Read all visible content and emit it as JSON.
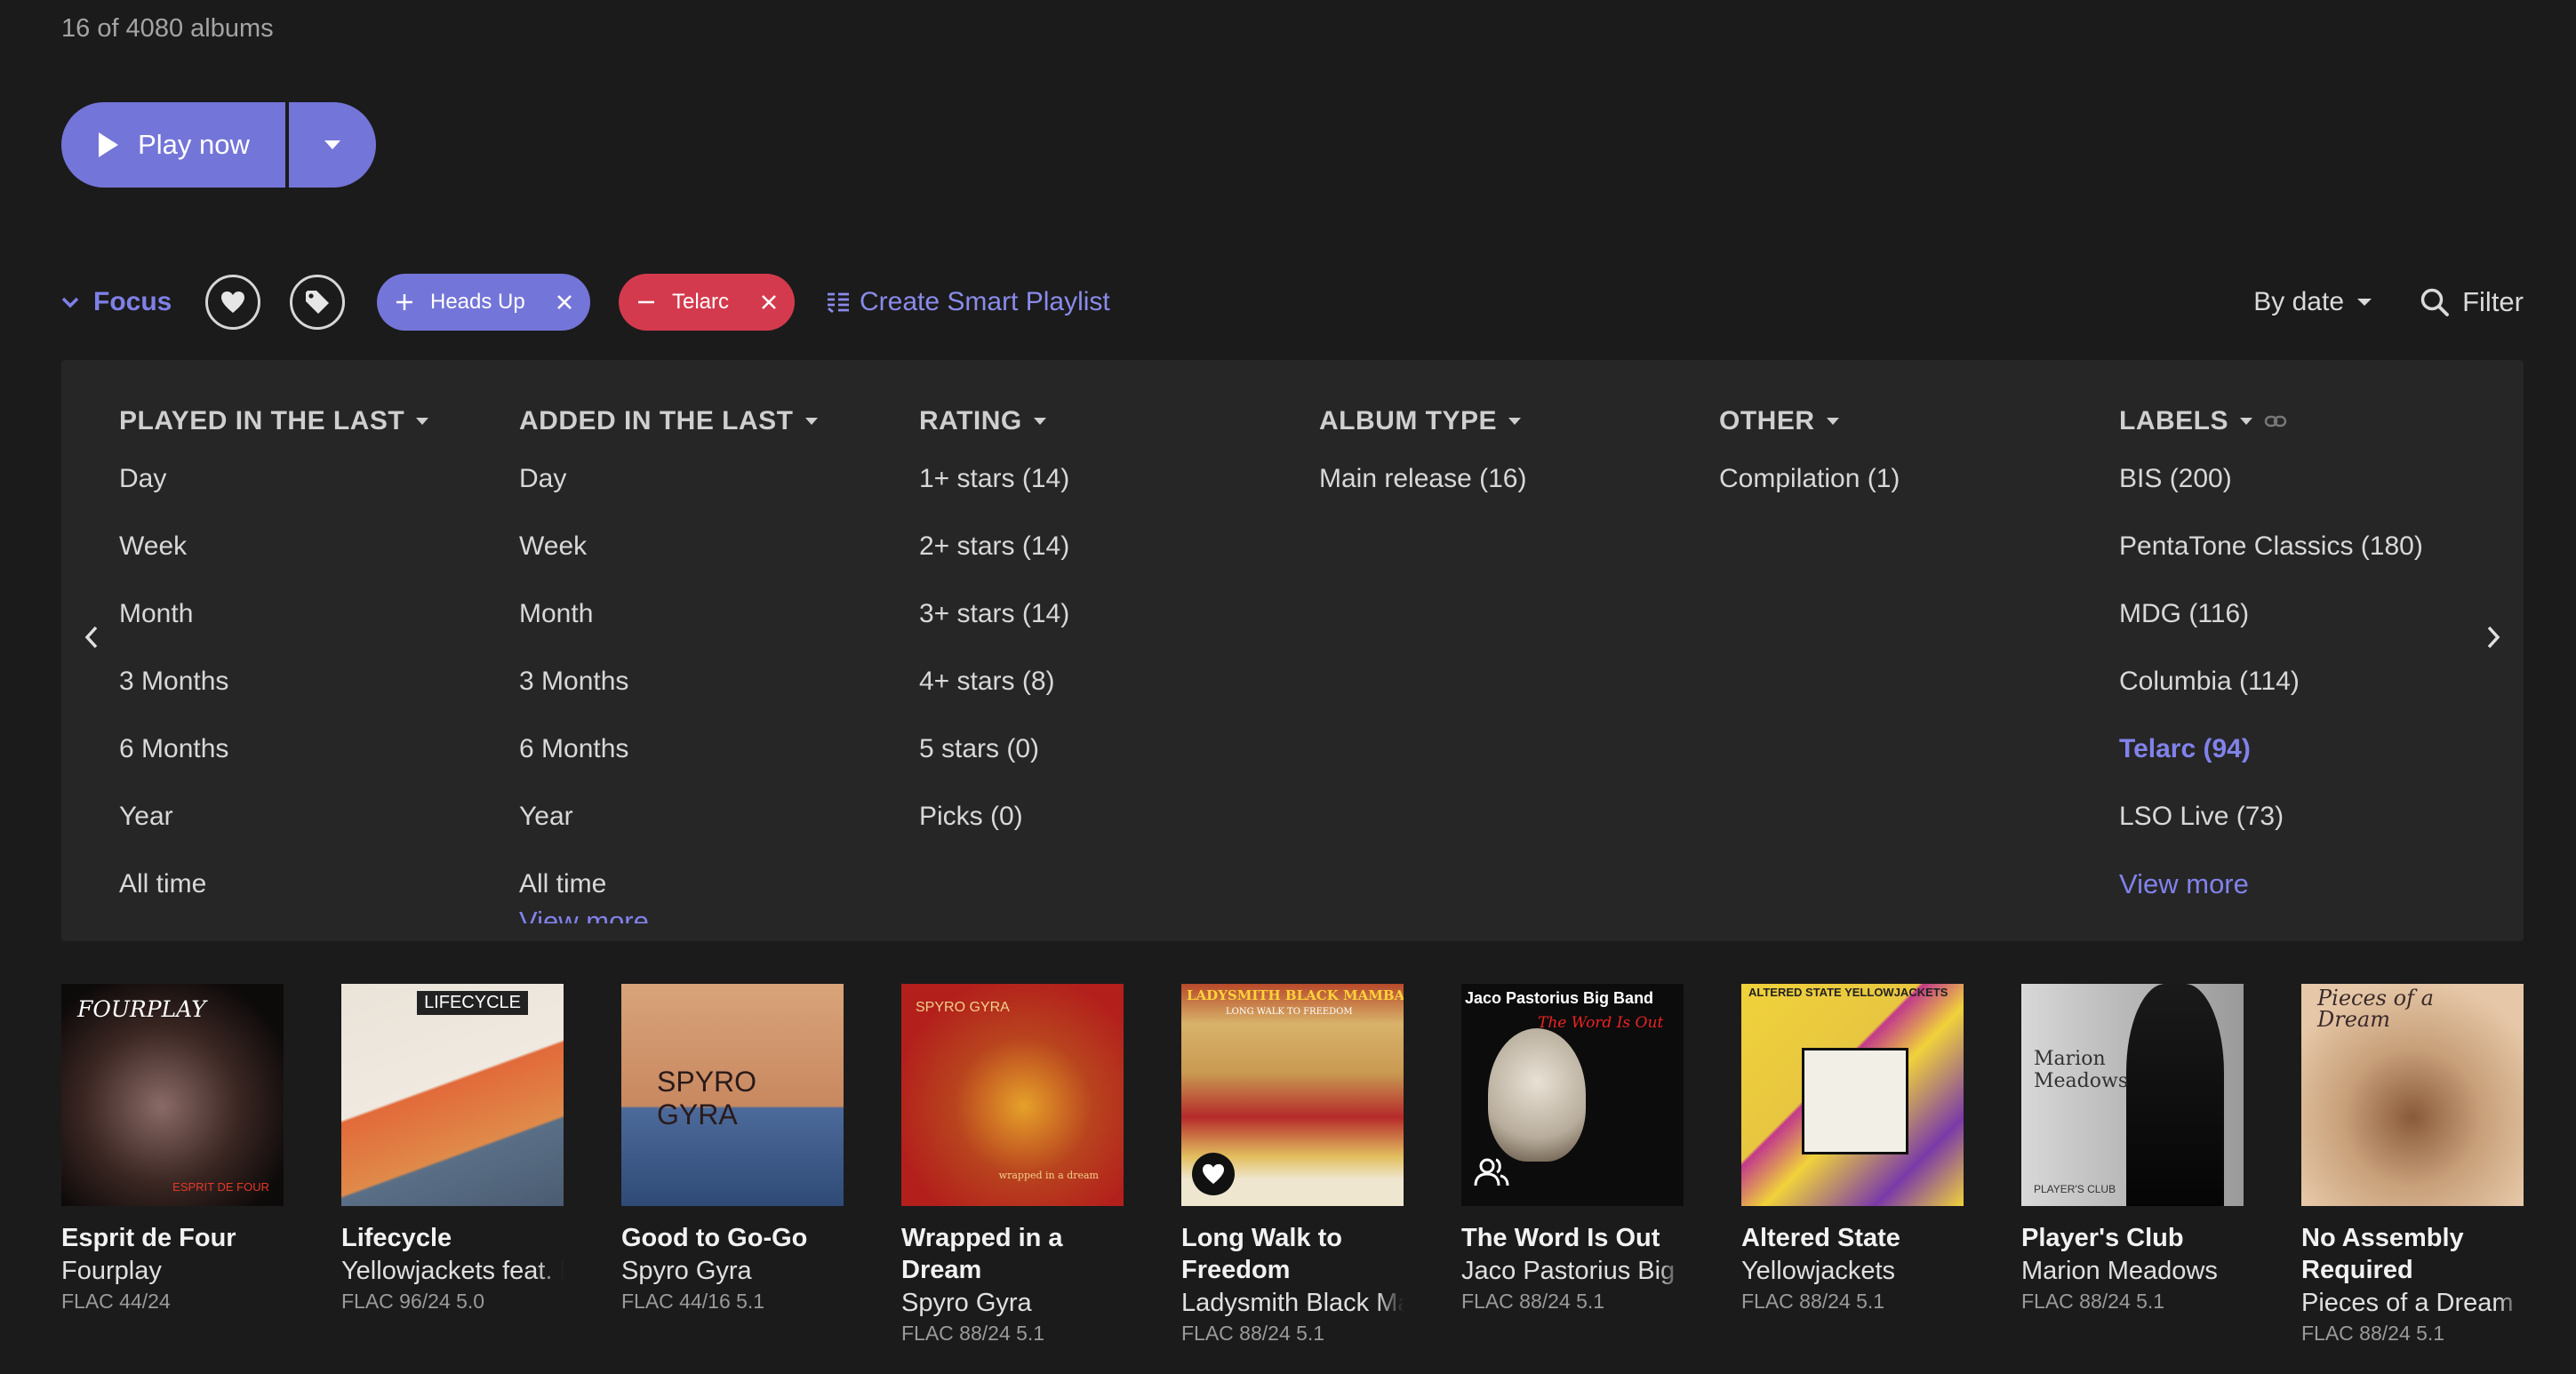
{
  "header": {
    "album_count": "16 of 4080 albums"
  },
  "play": {
    "label": "Play now"
  },
  "toolbar": {
    "focus_label": "Focus",
    "include_chip": "Heads Up",
    "exclude_chip": "Telarc",
    "smart_playlist": "Create Smart Playlist",
    "sort_label": "By date",
    "filter_label": "Filter"
  },
  "focus_panel": {
    "columns": [
      {
        "header": "PLAYED IN THE LAST",
        "items": [
          "Day",
          "Week",
          "Month",
          "3 Months",
          "6 Months",
          "Year",
          "All time"
        ]
      },
      {
        "header": "ADDED IN THE LAST",
        "items": [
          "Day",
          "Week",
          "Month",
          "3 Months",
          "6 Months",
          "Year",
          "All time"
        ],
        "view_more": "View more"
      },
      {
        "header": "RATING",
        "items": [
          "1+ stars (14)",
          "2+ stars (14)",
          "3+ stars (14)",
          "4+ stars (8)",
          "5 stars (0)",
          "Picks (0)"
        ]
      },
      {
        "header": "ALBUM TYPE",
        "items": [
          "Main release (16)"
        ]
      },
      {
        "header": "OTHER",
        "items": [
          "Compilation (1)"
        ]
      },
      {
        "header": "LABELS",
        "items": [
          "BIS (200)",
          "PentaTone Classics (180)",
          "MDG (116)",
          "Columbia (114)",
          "Telarc (94)",
          "LSO Live (73)"
        ],
        "active_item": "Telarc (94)",
        "view_more": "View more"
      }
    ]
  },
  "albums": [
    {
      "title": "Esprit de Four",
      "artist": "Fourplay",
      "format": "FLAC 44/24",
      "cover_text": "FOURPLAY",
      "cover_sub": "ESPRIT DE FOUR"
    },
    {
      "title": "Lifecycle",
      "artist": "Yellowjackets feat. Mike Stern",
      "format": "FLAC 96/24 5.0",
      "cover_text": "LIFECYCLE"
    },
    {
      "title": "Good to Go-Go",
      "artist": "Spyro Gyra",
      "format": "FLAC 44/16 5.1",
      "cover_text": "SPYRO GYRA"
    },
    {
      "title": "Wrapped in a Dream",
      "artist": "Spyro Gyra",
      "format": "FLAC 88/24 5.1",
      "cover_text": "SPYRO GYRA",
      "cover_sub": "wrapped in a dream"
    },
    {
      "title": "Long Walk to Freedom",
      "artist": "Ladysmith Black Mambazo",
      "format": "FLAC 88/24 5.1",
      "cover_text": "LADYSMITH BLACK MAMBAZO",
      "cover_sub": "LONG WALK TO FREEDOM"
    },
    {
      "title": "The Word Is Out",
      "artist": "Jaco Pastorius Big Band",
      "format": "FLAC 88/24 5.1",
      "cover_text": "Jaco Pastorius Big Band",
      "cover_sub": "The Word Is Out"
    },
    {
      "title": "Altered State",
      "artist": "Yellowjackets",
      "format": "FLAC 88/24 5.1",
      "cover_text": "ALTERED STATE  YELLOWJACKETS"
    },
    {
      "title": "Player's Club",
      "artist": "Marion Meadows",
      "format": "FLAC 88/24 5.1",
      "cover_text": "Marion Meadows",
      "cover_sub": "PLAYER'S CLUB"
    },
    {
      "title": "No Assembly Required",
      "artist": "Pieces of a Dream",
      "format": "FLAC 88/24 5.1",
      "cover_text": "Pieces of a Dream"
    }
  ],
  "colors": {
    "accent": "#7475d8",
    "exclude": "#d43a4d",
    "background": "#1b1b1c",
    "panel": "#262627"
  },
  "icons": [
    "play-icon",
    "chevron-down-icon",
    "heart-icon",
    "tag-icon",
    "plus-icon",
    "minus-icon",
    "close-icon",
    "playlist-add-icon",
    "search-icon",
    "chevron-left-icon",
    "chevron-right-icon",
    "link-icon",
    "people-icon"
  ]
}
